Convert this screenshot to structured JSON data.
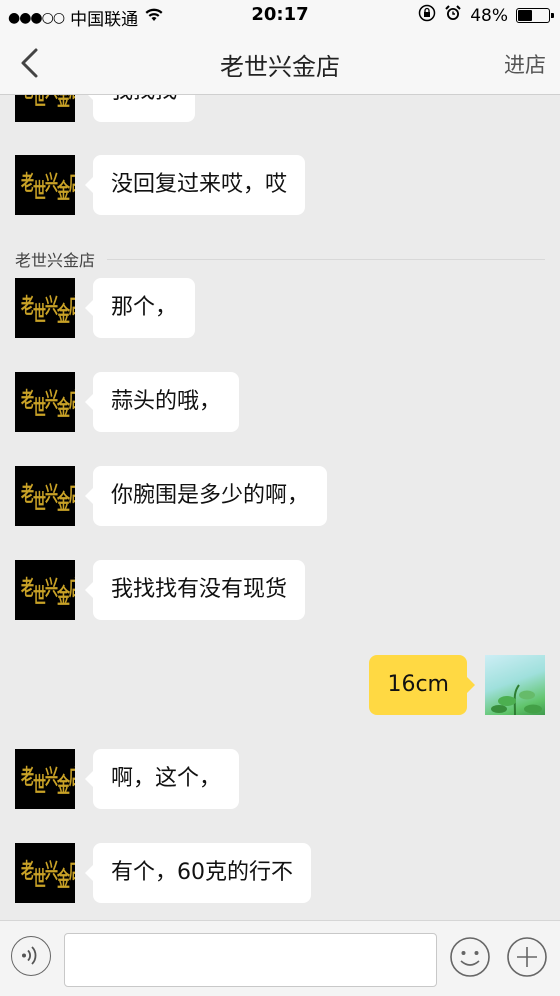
{
  "status_bar": {
    "signal_dots": "●●●○○",
    "carrier": "中国联通",
    "time": "20:17",
    "battery_percent": "48%",
    "battery_level": 0.48,
    "icons": [
      "wifi-icon",
      "orientation-lock-icon",
      "alarm-icon",
      "battery-icon"
    ]
  },
  "nav": {
    "title": "老世兴金店",
    "action_label": "进店"
  },
  "messages": [
    {
      "from": "shop",
      "text": "我找找"
    },
    {
      "from": "shop",
      "text": "没回复过来哎，哎"
    },
    {
      "sender_label": "老世兴金店"
    },
    {
      "from": "shop",
      "text": "那个，"
    },
    {
      "from": "shop",
      "text": "蒜头的哦，"
    },
    {
      "from": "shop",
      "text": "你腕围是多少的啊，"
    },
    {
      "from": "shop",
      "text": "我找找有没有现货"
    },
    {
      "from": "me",
      "text": "16cm"
    },
    {
      "from": "shop",
      "text": "啊，这个，"
    },
    {
      "from": "shop",
      "text": "有个，60克的行不"
    }
  ],
  "avatar_text": "老世兴金店",
  "colors": {
    "my_bubble": "#ffd943",
    "their_bubble": "#ffffff",
    "chat_background": "#ebebeb",
    "avatar_gold": "#c9a227"
  },
  "input_bar": {
    "voice_icon": "voice-icon",
    "emoji_icon": "emoji-icon",
    "plus_icon": "plus-icon",
    "placeholder": ""
  }
}
